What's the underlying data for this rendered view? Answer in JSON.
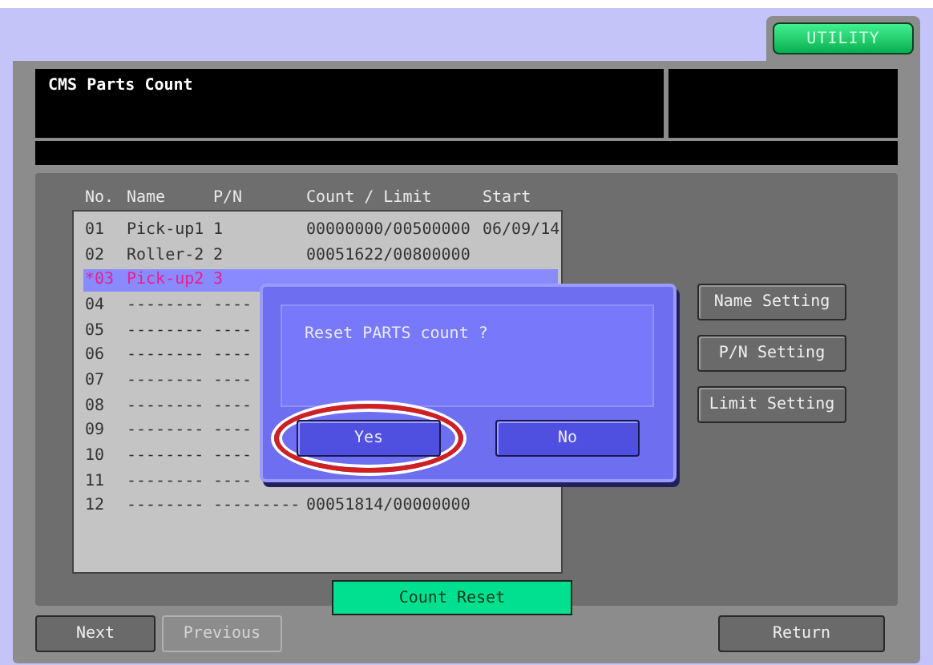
{
  "mode_tab": {
    "label": "UTILITY"
  },
  "header": {
    "title": "CMS Parts Count"
  },
  "table": {
    "columns": [
      "No.",
      "Name",
      "P/N",
      "Count / Limit",
      "Start"
    ],
    "rows": [
      {
        "no": "01",
        "name": "Pick-up1",
        "pn": "1",
        "count": "00000000/00500000",
        "start": "06/09/14",
        "selected": false
      },
      {
        "no": "02",
        "name": "Roller-2",
        "pn": "2",
        "count": "00051622/00800000",
        "selected": false
      },
      {
        "no": "*03",
        "name": "Pick-up2",
        "pn": "3",
        "selected": true
      },
      {
        "no": "04",
        "name": "--------",
        "pn": "----",
        "selected": false
      },
      {
        "no": "05",
        "name": "--------",
        "pn": "----",
        "selected": false
      },
      {
        "no": "06",
        "name": "--------",
        "pn": "----",
        "selected": false
      },
      {
        "no": "07",
        "name": "--------",
        "pn": "----",
        "selected": false
      },
      {
        "no": "08",
        "name": "--------",
        "pn": "----",
        "selected": false
      },
      {
        "no": "09",
        "name": "--------",
        "pn": "----",
        "selected": false
      },
      {
        "no": "10",
        "name": "--------",
        "pn": "----",
        "selected": false
      },
      {
        "no": "11",
        "name": "--------",
        "pn": "----",
        "selected": false
      },
      {
        "no": "12",
        "name": "--------",
        "pn": "---------",
        "count": "00051814/00000000",
        "selected": false
      }
    ]
  },
  "side_buttons": [
    "Name Setting",
    "P/N Setting",
    "Limit Setting"
  ],
  "count_reset": {
    "label": "Count Reset"
  },
  "dialog": {
    "message": "Reset PARTS count ?",
    "buttons": [
      {
        "label": "Yes",
        "highlighted": true
      },
      {
        "label": "No",
        "highlighted": false
      }
    ]
  },
  "footer": {
    "buttons": [
      {
        "label": "Next",
        "disabled": false
      },
      {
        "label": "Previous",
        "disabled": true
      }
    ],
    "return": {
      "label": "Return"
    }
  }
}
